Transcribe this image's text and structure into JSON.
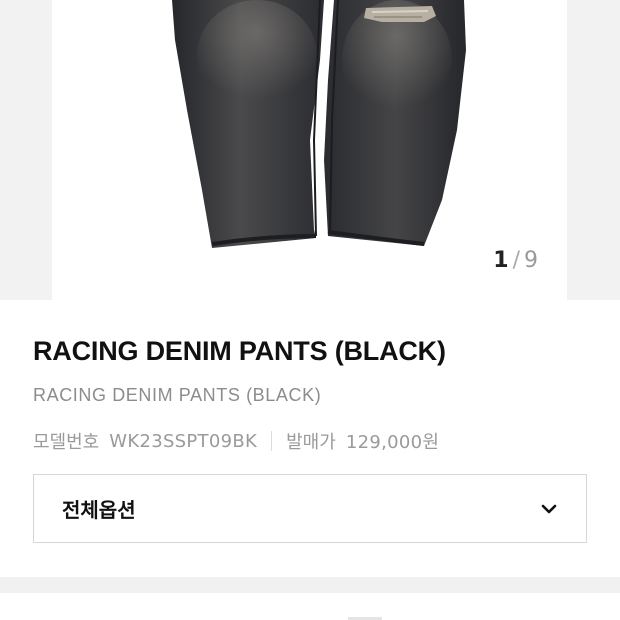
{
  "gallery": {
    "current": "1",
    "separator": "/",
    "total": "9",
    "image_alt": "black denim pants photo"
  },
  "product": {
    "title": "RACING DENIM PANTS (BLACK)",
    "subtitle": "RACING DENIM PANTS (BLACK)",
    "model_label": "모델번호",
    "model_value": "WK23SSPT09BK",
    "price_label": "발매가",
    "price_value": "129,000원"
  },
  "options": {
    "label": "전체옵션",
    "icon": "chevron-down-icon"
  },
  "colors": {
    "accent_text": "#111111",
    "muted_text": "#9a9a9a",
    "denim": "#2f3034"
  }
}
